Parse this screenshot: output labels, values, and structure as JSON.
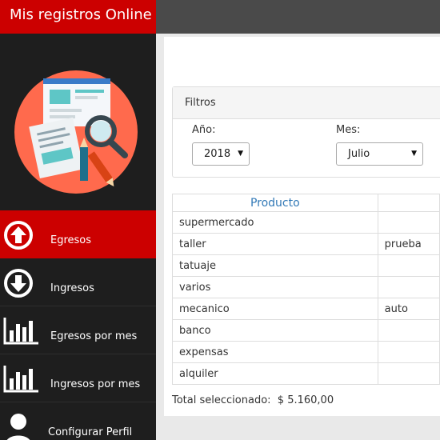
{
  "app": {
    "title": "Mis registros Online"
  },
  "sidebar": {
    "items": [
      {
        "label": "Egresos",
        "icon": "arrow-up-circle-icon",
        "active": true
      },
      {
        "label": "Ingresos",
        "icon": "arrow-down-circle-icon",
        "active": false
      },
      {
        "label": "Egresos por mes",
        "icon": "bar-chart-icon",
        "active": false
      },
      {
        "label": "Ingresos por mes",
        "icon": "bar-chart-icon",
        "active": false
      },
      {
        "label": "Configurar Perfil",
        "icon": "user-icon",
        "active": false
      }
    ]
  },
  "filters": {
    "title": "Filtros",
    "year_label": "Año:",
    "year_value": "2018",
    "month_label": "Mes:",
    "month_value": "Julio"
  },
  "table": {
    "headers": [
      "Producto",
      ""
    ],
    "rows": [
      [
        "supermercado",
        ""
      ],
      [
        "taller",
        "prueba"
      ],
      [
        "tatuaje",
        ""
      ],
      [
        "varios",
        ""
      ],
      [
        "mecanico",
        "auto"
      ],
      [
        "banco",
        ""
      ],
      [
        "expensas",
        ""
      ],
      [
        "alquiler",
        ""
      ]
    ]
  },
  "total": {
    "label": "Total seleccionado:",
    "value": "$ 5.160,00"
  },
  "colors": {
    "brand": "#cc0000",
    "sidebar": "#1e1e1e",
    "topbar": "#4a4a4a",
    "logo_circle": "#ff6a4d"
  }
}
